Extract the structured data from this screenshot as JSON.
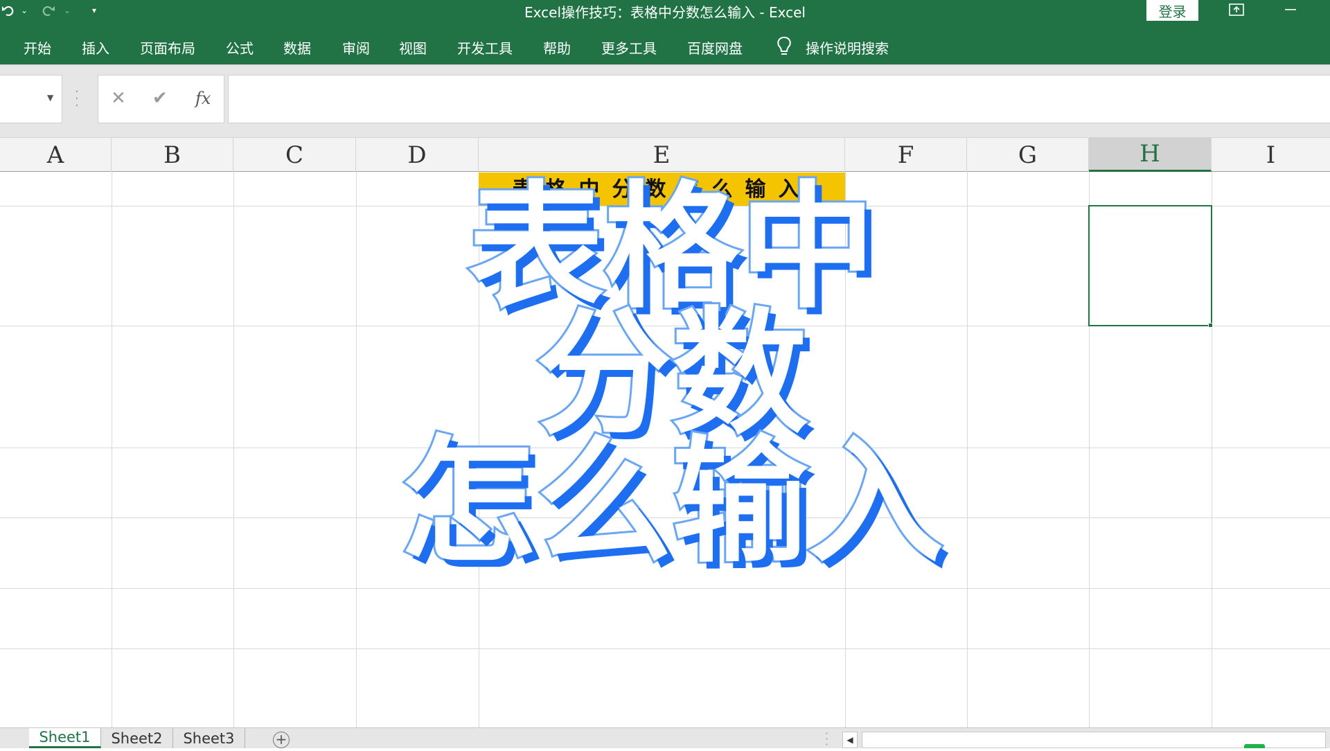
{
  "window": {
    "title": "Excel操作技巧：表格中分数怎么输入  -  Excel",
    "login_label": "登录"
  },
  "quick_access": {
    "undo_icon": "undo-icon",
    "redo_icon": "redo-icon",
    "customize_icon": "customize-qat-icon"
  },
  "ribbon": {
    "tabs": [
      "开始",
      "插入",
      "页面布局",
      "公式",
      "数据",
      "审阅",
      "视图",
      "开发工具",
      "帮助",
      "更多工具",
      "百度网盘"
    ],
    "tell_me": "操作说明搜索"
  },
  "formula_bar": {
    "name_box": "",
    "cancel_symbol": "✕",
    "enter_symbol": "✔",
    "fx_label": "fx",
    "formula": ""
  },
  "grid": {
    "columns": [
      "A",
      "B",
      "C",
      "D",
      "E",
      "F",
      "G",
      "H",
      "I"
    ],
    "selected_column": "H",
    "title_cell_text": "表格中分数怎么输入",
    "title_cell_color": "#f5c400"
  },
  "overlay": {
    "line1": "表格中",
    "line2": "分数",
    "line3": "怎么输入",
    "fill_color": "#ffffff",
    "stroke_color": "#6aa6f4",
    "shadow_color": "#1e6ef2"
  },
  "sheets": {
    "tabs": [
      "Sheet1",
      "Sheet2",
      "Sheet3"
    ],
    "active": "Sheet1",
    "add_symbol": "+"
  },
  "colors": {
    "brand_green": "#217346"
  }
}
